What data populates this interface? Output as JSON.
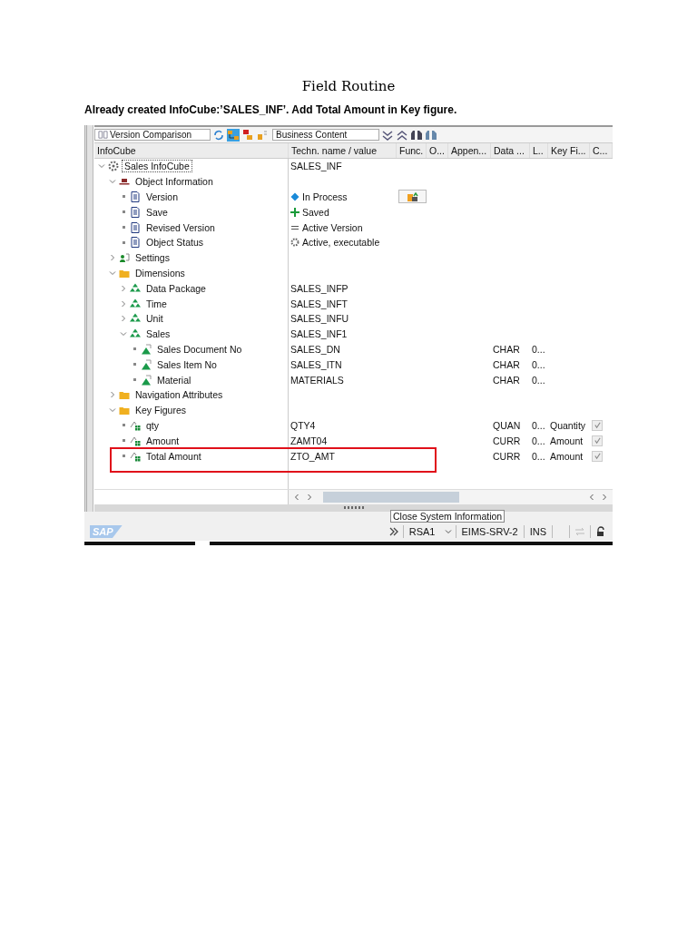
{
  "doc": {
    "title": "Field Routine",
    "intro": "Already created InfoCube:’SALES_INF’. Add Total Amount in Key figure."
  },
  "window": {
    "toolbar": {
      "version_dropdown": "Version Comparison",
      "content_dropdown": "Business Content"
    },
    "columns": [
      "InfoCube",
      "Techn. name / value",
      "Func.",
      "O...",
      "Appen...",
      "Data ...",
      "L..",
      "Key Fi...",
      "C..."
    ],
    "tree": [
      {
        "label": "Sales InfoCube",
        "kind": "infocube",
        "tech": "SALES_INF",
        "focused": true,
        "expanded": true,
        "children": [
          {
            "label": "Object Information",
            "kind": "group",
            "expanded": true,
            "children": [
              {
                "label": "Version",
                "kind": "property",
                "status": {
                  "kind": "in-process",
                  "text": "In Process"
                },
                "action": {
                  "kind": "transport"
                }
              },
              {
                "label": "Save",
                "kind": "property",
                "status": {
                  "kind": "saved",
                  "text": "Saved"
                }
              },
              {
                "label": "Revised Version",
                "kind": "property",
                "status": {
                  "kind": "equal",
                  "text": "Active Version"
                }
              },
              {
                "label": "Object Status",
                "kind": "property",
                "status": {
                  "kind": "active",
                  "text": "Active, executable"
                }
              }
            ]
          },
          {
            "label": "Settings",
            "kind": "settings",
            "expanded": false
          },
          {
            "label": "Dimensions",
            "kind": "folder",
            "expanded": true,
            "children": [
              {
                "label": "Data Package",
                "kind": "dimension",
                "tech": "SALES_INFP",
                "expanded": false
              },
              {
                "label": "Time",
                "kind": "dimension",
                "tech": "SALES_INFT",
                "expanded": false
              },
              {
                "label": "Unit",
                "kind": "dimension",
                "tech": "SALES_INFU",
                "expanded": false
              },
              {
                "label": "Sales",
                "kind": "dimension",
                "tech": "SALES_INF1",
                "expanded": true,
                "children": [
                  {
                    "label": "Sales Document No",
                    "kind": "characteristic",
                    "tech": "SALES_DN",
                    "data_type": "CHAR",
                    "length": "0..."
                  },
                  {
                    "label": "Sales Item No",
                    "kind": "characteristic",
                    "tech": "SALES_ITN",
                    "data_type": "CHAR",
                    "length": "0..."
                  },
                  {
                    "label": "Material",
                    "kind": "characteristic",
                    "tech": "MATERIALS",
                    "data_type": "CHAR",
                    "length": "0..."
                  }
                ]
              }
            ]
          },
          {
            "label": "Navigation Attributes",
            "kind": "folder",
            "expanded": false
          },
          {
            "label": "Key Figures",
            "kind": "folder",
            "expanded": true,
            "children": [
              {
                "label": "qty",
                "kind": "keyfigure",
                "tech": "QTY4",
                "data_type": "QUAN",
                "length": "0...",
                "kf_type": "Quantity",
                "checked": true
              },
              {
                "label": "Amount",
                "kind": "keyfigure",
                "tech": "ZAMT04",
                "data_type": "CURR",
                "length": "0...",
                "kf_type": "Amount",
                "checked": true
              },
              {
                "label": "Total Amount",
                "kind": "keyfigure",
                "tech": "ZTO_AMT",
                "data_type": "CURR",
                "length": "0...",
                "kf_type": "Amount",
                "checked": true,
                "highlighted": true
              }
            ]
          }
        ]
      }
    ],
    "status_bar": {
      "logo": "SAP",
      "tooltip": "Close System Information",
      "transaction": "RSA1",
      "server": "EIMS-SRV-2",
      "mode": "INS"
    }
  }
}
